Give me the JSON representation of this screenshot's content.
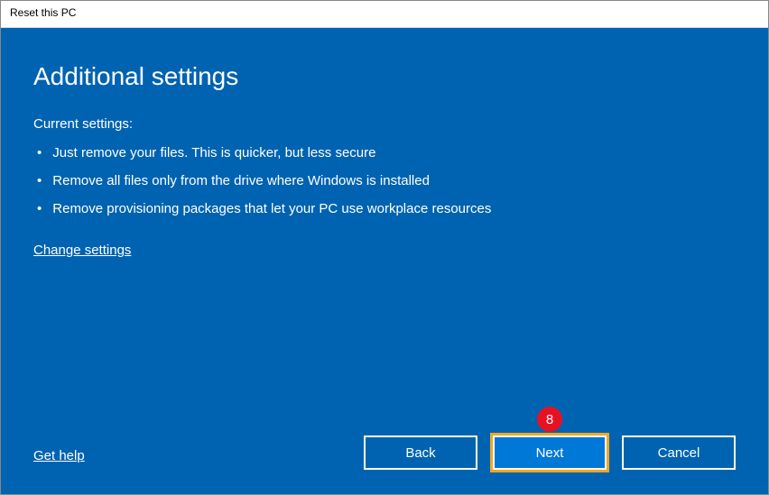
{
  "window": {
    "title": "Reset this PC"
  },
  "main": {
    "heading": "Additional settings",
    "subheading": "Current settings:",
    "bullets": [
      "Just remove your files. This is quicker, but less secure",
      "Remove all files only from the drive where Windows is installed",
      "Remove provisioning packages that let your PC use workplace resources"
    ],
    "change_link": "Change settings",
    "help_link": "Get help"
  },
  "buttons": {
    "back": "Back",
    "next": "Next",
    "cancel": "Cancel"
  },
  "annotation": {
    "badge": "8"
  }
}
